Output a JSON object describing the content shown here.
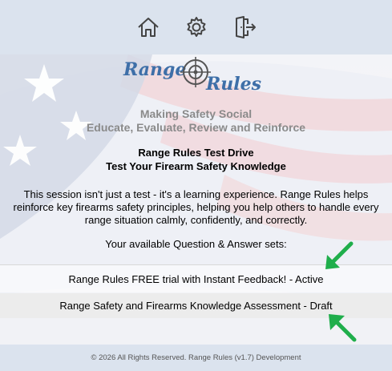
{
  "nav": {
    "home_icon": "home-icon",
    "settings_icon": "gear-icon",
    "logout_icon": "logout-icon"
  },
  "logo": {
    "word1": "Range",
    "word2": "Rules",
    "color": "#3e6fa8"
  },
  "tagline": {
    "line1": "Making Safety Social",
    "line2": "Educate, Evaluate, Review and Reinforce"
  },
  "heading": {
    "line1": "Range Rules Test Drive",
    "line2": "Test Your Firearm Safety Knowledge"
  },
  "intro": "This session isn't just a test - it's a learning experience. Range Rules helps reinforce key firearms safety principles, helping you help others to handle every range situation calmly, confidently, and correctly.",
  "available_label": "Your available Question & Answer sets:",
  "question_sets": [
    {
      "label": "Range Rules FREE trial with Instant Feedback! - Active"
    },
    {
      "label": "Range Safety and Firearms Knowledge Assessment - Draft"
    }
  ],
  "annotation": {
    "arrow_color": "#1fae4b"
  },
  "footer": "© 2026 All Rights Reserved. Range Rules (v1.7) Development"
}
